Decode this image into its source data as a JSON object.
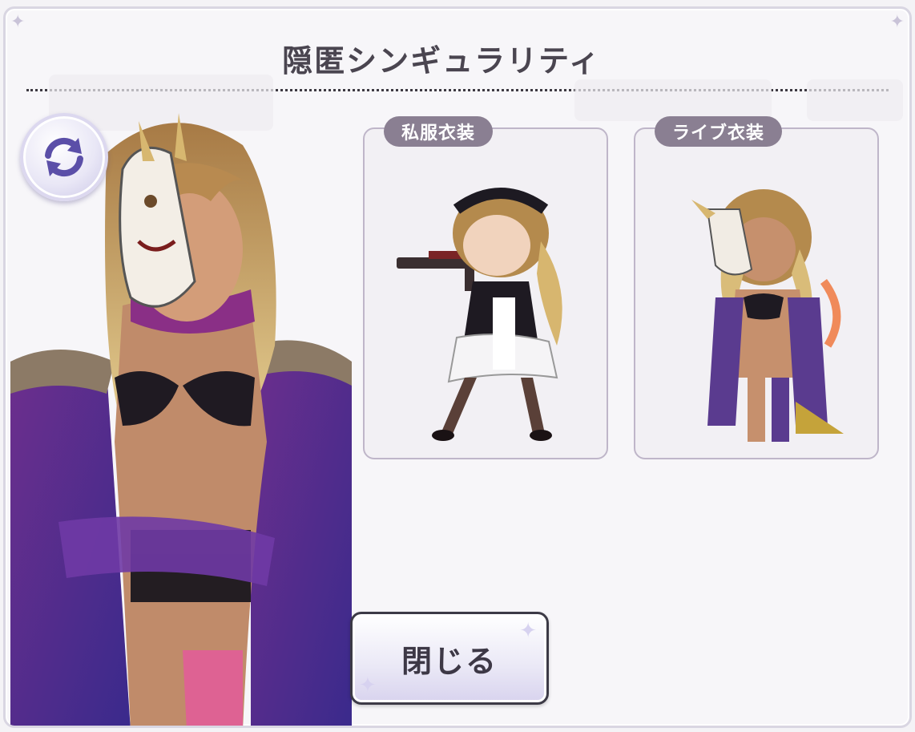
{
  "dialog": {
    "title": "隠匿シンギュラリティ"
  },
  "outfits": {
    "casual_label": "私服衣装",
    "live_label": "ライブ衣装"
  },
  "buttons": {
    "close_label": "閉じる"
  },
  "icons": {
    "refresh": "refresh-arrows-icon"
  },
  "colors": {
    "label_bg": "#8a7f92",
    "divider": "#3d3a42",
    "button_border": "#3c3a46"
  }
}
